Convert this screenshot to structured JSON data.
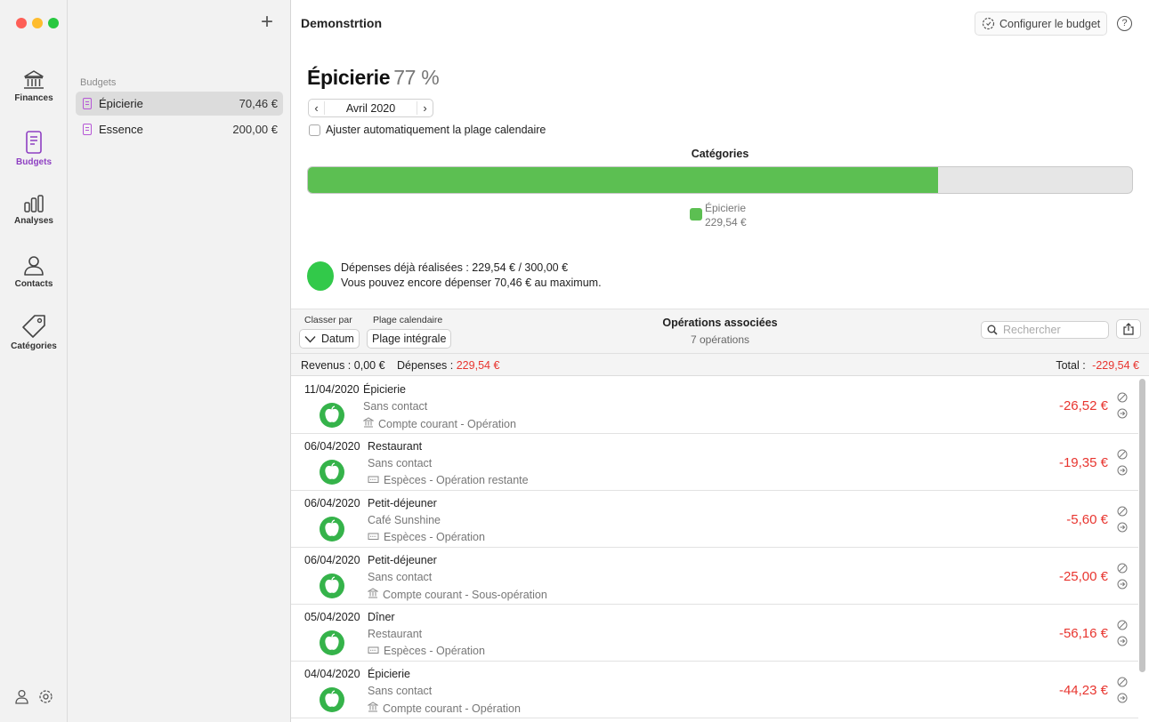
{
  "rail": {
    "items": [
      {
        "label": "Finances",
        "icon": "bank-icon"
      },
      {
        "label": "Budgets",
        "icon": "budget-doc-icon",
        "active": true
      },
      {
        "label": "Analyses",
        "icon": "bar-chart-icon"
      },
      {
        "label": "Contacts",
        "icon": "person-icon"
      },
      {
        "label": "Catégories",
        "icon": "tag-icon"
      }
    ]
  },
  "sidebar": {
    "section_label": "Budgets",
    "add_label": "+",
    "budgets": [
      {
        "name": "Épicierie",
        "amount": "70,46 €"
      },
      {
        "name": "Essence",
        "amount": "200,00 €"
      }
    ]
  },
  "header": {
    "title": "Demonstrtion",
    "configure_label": "Configurer le budget",
    "help_label": "?"
  },
  "budget": {
    "name": "Épicierie",
    "percent_label": "77 %",
    "progress": 0.7651,
    "month": "Avril 2020",
    "auto_adjust_label": "Ajuster automatiquement la plage calendaire",
    "categories_heading": "Catégories",
    "legend_name": "Épicierie",
    "legend_amount": "229,54 €",
    "status_line1": "Dépenses déjà réalisées : 229,54 € / 300,00 €",
    "status_line2": "Vous pouvez encore dépenser 70,46 € au maximum.",
    "colors": {
      "fill": "#5cbf52",
      "status": "#32c94a",
      "negative": "#e8352f",
      "accent": "#8e3fc2"
    }
  },
  "ops": {
    "sort_label": "Classer par",
    "sort_value": "Datum",
    "range_label": "Plage calendaire",
    "range_value": "Plage intégrale",
    "title": "Opérations associées",
    "count": "7 opérations",
    "search_placeholder": "Rechercher",
    "revenus_label": "Revenus :",
    "revenus_value": "0,00 €",
    "depenses_label": "Dépenses :",
    "depenses_value": "229,54 €",
    "total_label": "Total :",
    "total_value": "-229,54 €",
    "rows": [
      {
        "date": "11/04/2020",
        "name": "Épicierie",
        "contact": "Sans contact",
        "account": "Compte courant - Opération",
        "account_icon": "bank",
        "amount": "-26,52 €"
      },
      {
        "date": "06/04/2020",
        "name": "Restaurant",
        "contact": "Sans contact",
        "account": "Espèces - Opération restante",
        "account_icon": "cash",
        "amount": "-19,35 €"
      },
      {
        "date": "06/04/2020",
        "name": "Petit-déjeuner",
        "contact": "Café Sunshine",
        "account": "Espèces - Opération",
        "account_icon": "cash",
        "amount": "-5,60 €"
      },
      {
        "date": "06/04/2020",
        "name": "Petit-déjeuner",
        "contact": "Sans contact",
        "account": "Compte courant - Sous-opération",
        "account_icon": "bank",
        "amount": "-25,00 €"
      },
      {
        "date": "05/04/2020",
        "name": "Dîner",
        "contact": "Restaurant",
        "account": "Espèces - Opération",
        "account_icon": "cash",
        "amount": "-56,16 €"
      },
      {
        "date": "04/04/2020",
        "name": "Épicierie",
        "contact": "Sans contact",
        "account": "Compte courant - Opération",
        "account_icon": "bank",
        "amount": "-44,23 €"
      }
    ]
  }
}
